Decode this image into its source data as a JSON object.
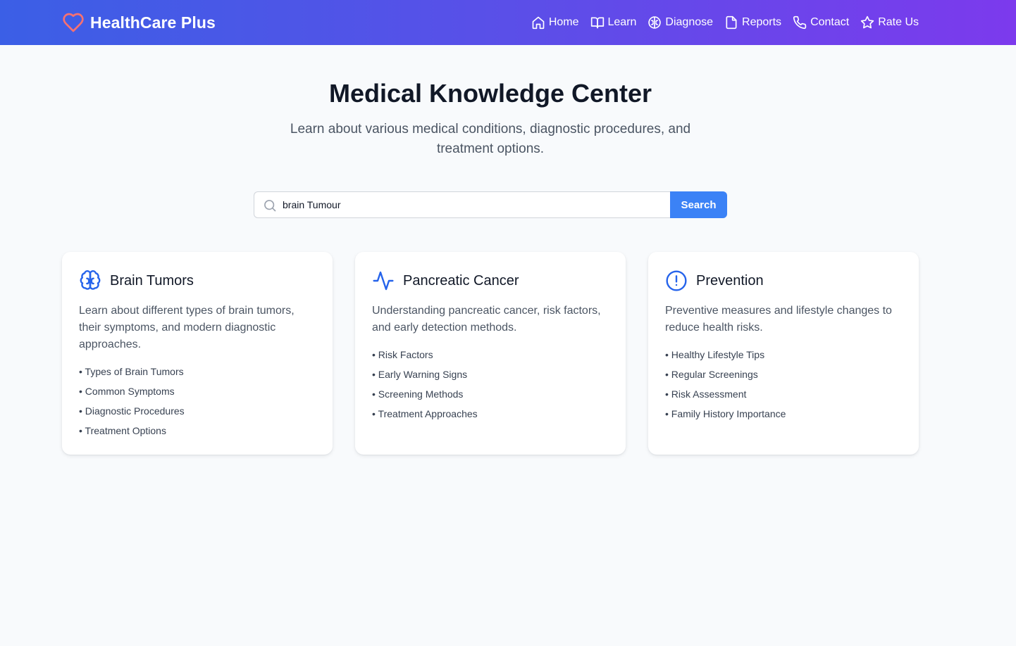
{
  "nav": {
    "brand": "HealthCare Plus",
    "items": [
      {
        "label": "Home",
        "icon": "home-icon"
      },
      {
        "label": "Learn",
        "icon": "book-icon"
      },
      {
        "label": "Diagnose",
        "icon": "brain-icon"
      },
      {
        "label": "Reports",
        "icon": "file-icon"
      },
      {
        "label": "Contact",
        "icon": "phone-icon"
      },
      {
        "label": "Rate Us",
        "icon": "star-icon"
      }
    ]
  },
  "hero": {
    "title": "Medical Knowledge Center",
    "subtitle": "Learn about various medical conditions, diagnostic procedures, and treatment options."
  },
  "search": {
    "value": "brain Tumour",
    "button": "Search"
  },
  "cards": [
    {
      "icon": "brain-icon",
      "title": "Brain Tumors",
      "description": "Learn about different types of brain tumors, their symptoms, and modern diagnostic approaches.",
      "items": [
        "Types of Brain Tumors",
        "Common Symptoms",
        "Diagnostic Procedures",
        "Treatment Options"
      ]
    },
    {
      "icon": "activity-icon",
      "title": "Pancreatic Cancer",
      "description": "Understanding pancreatic cancer, risk factors, and early detection methods.",
      "items": [
        "Risk Factors",
        "Early Warning Signs",
        "Screening Methods",
        "Treatment Approaches"
      ]
    },
    {
      "icon": "alert-circle-icon",
      "title": "Prevention",
      "description": "Preventive measures and lifestyle changes to reduce health risks.",
      "items": [
        "Healthy Lifestyle Tips",
        "Regular Screenings",
        "Risk Assessment",
        "Family History Importance"
      ]
    }
  ],
  "colors": {
    "nav_gradient_start": "#3b5fe6",
    "nav_gradient_end": "#7c3aed",
    "brand_heart": "#f87171",
    "accent": "#3b82f6",
    "card_icon": "#2563eb"
  }
}
